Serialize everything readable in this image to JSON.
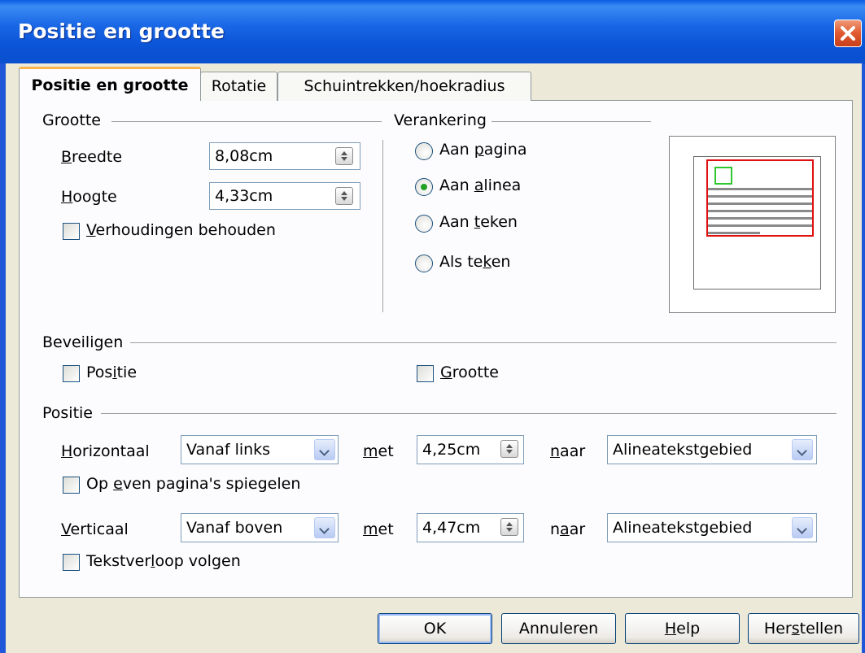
{
  "window": {
    "title": "Positie en grootte"
  },
  "tabs": [
    {
      "label": "Positie en grootte",
      "active": true
    },
    {
      "label": "Rotatie",
      "active": false
    },
    {
      "label": "Schuintrekken/hoekradius",
      "active": false
    }
  ],
  "size": {
    "group_label": "Grootte",
    "width_label": "Breedte",
    "width_value": "8,08cm",
    "height_label": "Hoogte",
    "height_value": "4,33cm",
    "keep_ratio_label": "Verhoudingen behouden",
    "keep_ratio_checked": false
  },
  "anchor": {
    "group_label": "Verankering",
    "options": [
      {
        "label": "Aan pagina",
        "checked": false
      },
      {
        "label": "Aan alinea",
        "checked": true
      },
      {
        "label": "Aan teken",
        "checked": false
      },
      {
        "label": "Als teken",
        "checked": false
      }
    ]
  },
  "protect": {
    "group_label": "Beveiligen",
    "position_label": "Positie",
    "position_checked": false,
    "size_label": "Grootte",
    "size_checked": false
  },
  "position": {
    "group_label": "Positie",
    "horizontal_label": "Horizontaal",
    "horizontal_value": "Vanaf links",
    "horizontal_by_label": "met",
    "horizontal_by_value": "4,25cm",
    "horizontal_to_label": "naar",
    "horizontal_to_value": "Alineatekstgebied",
    "mirror_label": "Op even pagina's spiegelen",
    "mirror_checked": false,
    "vertical_label": "Verticaal",
    "vertical_value": "Vanaf boven",
    "vertical_by_label": "met",
    "vertical_by_value": "4,47cm",
    "vertical_to_label": "naar",
    "vertical_to_value": "Alineatekstgebied",
    "follow_flow_label": "Tekstverloop volgen",
    "follow_flow_checked": false
  },
  "buttons": {
    "ok": "OK",
    "cancel": "Annuleren",
    "help": "Help",
    "reset": "Herstellen"
  },
  "icons": {
    "close": "close-icon",
    "spin": "spin-arrows-icon",
    "dropdown": "chevron-down-icon"
  },
  "colors": {
    "titlebar": "#0A5CE3",
    "dialog_bg": "#ECE9D8",
    "active_tab_highlight": "#F8B34A",
    "preview_paragraph": "#E01010",
    "preview_frame": "#2EC82E",
    "radio_dot": "#21A121"
  }
}
